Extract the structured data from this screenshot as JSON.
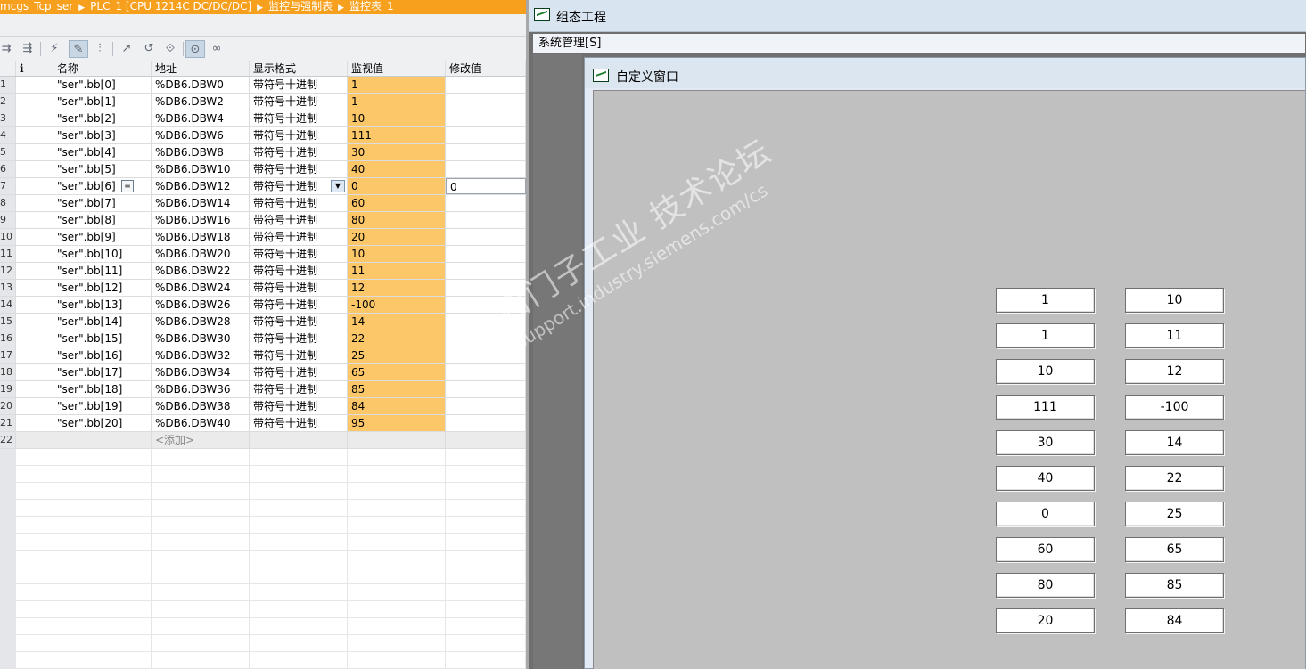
{
  "tia": {
    "breadcrumb": [
      "mcgs_Tcp_ser",
      "PLC_1 [CPU 1214C DC/DC/DC]",
      "监控与强制表",
      "监控表_1"
    ],
    "columns": {
      "info": "i",
      "name": "名称",
      "address": "地址",
      "format": "显示格式",
      "monitor": "监视值",
      "modify": "修改值"
    },
    "rows": [
      {
        "no": "1",
        "name": "\"ser\".bb[0]",
        "address": "%DB6.DBW0",
        "format": "带符号十进制",
        "monitor": "1"
      },
      {
        "no": "2",
        "name": "\"ser\".bb[1]",
        "address": "%DB6.DBW2",
        "format": "带符号十进制",
        "monitor": "1"
      },
      {
        "no": "3",
        "name": "\"ser\".bb[2]",
        "address": "%DB6.DBW4",
        "format": "带符号十进制",
        "monitor": "10"
      },
      {
        "no": "4",
        "name": "\"ser\".bb[3]",
        "address": "%DB6.DBW6",
        "format": "带符号十进制",
        "monitor": "111"
      },
      {
        "no": "5",
        "name": "\"ser\".bb[4]",
        "address": "%DB6.DBW8",
        "format": "带符号十进制",
        "monitor": "30"
      },
      {
        "no": "6",
        "name": "\"ser\".bb[5]",
        "address": "%DB6.DBW10",
        "format": "带符号十进制",
        "monitor": "40"
      },
      {
        "no": "7",
        "name": "\"ser\".bb[6]",
        "address": "%DB6.DBW12",
        "format": "带符号十进制",
        "monitor": "0",
        "modify": "0"
      },
      {
        "no": "8",
        "name": "\"ser\".bb[7]",
        "address": "%DB6.DBW14",
        "format": "带符号十进制",
        "monitor": "60"
      },
      {
        "no": "9",
        "name": "\"ser\".bb[8]",
        "address": "%DB6.DBW16",
        "format": "带符号十进制",
        "monitor": "80"
      },
      {
        "no": "10",
        "name": "\"ser\".bb[9]",
        "address": "%DB6.DBW18",
        "format": "带符号十进制",
        "monitor": "20"
      },
      {
        "no": "11",
        "name": "\"ser\".bb[10]",
        "address": "%DB6.DBW20",
        "format": "带符号十进制",
        "monitor": "10"
      },
      {
        "no": "12",
        "name": "\"ser\".bb[11]",
        "address": "%DB6.DBW22",
        "format": "带符号十进制",
        "monitor": "11"
      },
      {
        "no": "13",
        "name": "\"ser\".bb[12]",
        "address": "%DB6.DBW24",
        "format": "带符号十进制",
        "monitor": "12"
      },
      {
        "no": "14",
        "name": "\"ser\".bb[13]",
        "address": "%DB6.DBW26",
        "format": "带符号十进制",
        "monitor": "-100"
      },
      {
        "no": "15",
        "name": "\"ser\".bb[14]",
        "address": "%DB6.DBW28",
        "format": "带符号十进制",
        "monitor": "14"
      },
      {
        "no": "16",
        "name": "\"ser\".bb[15]",
        "address": "%DB6.DBW30",
        "format": "带符号十进制",
        "monitor": "22"
      },
      {
        "no": "17",
        "name": "\"ser\".bb[16]",
        "address": "%DB6.DBW32",
        "format": "带符号十进制",
        "monitor": "25"
      },
      {
        "no": "18",
        "name": "\"ser\".bb[17]",
        "address": "%DB6.DBW34",
        "format": "带符号十进制",
        "monitor": "65"
      },
      {
        "no": "19",
        "name": "\"ser\".bb[18]",
        "address": "%DB6.DBW36",
        "format": "带符号十进制",
        "monitor": "85"
      },
      {
        "no": "20",
        "name": "\"ser\".bb[19]",
        "address": "%DB6.DBW38",
        "format": "带符号十进制",
        "monitor": "84"
      },
      {
        "no": "21",
        "name": "\"ser\".bb[20]",
        "address": "%DB6.DBW40",
        "format": "带符号十进制",
        "monitor": "95"
      }
    ],
    "add_row": {
      "no": "22",
      "label": "<添加>"
    }
  },
  "mcgs": {
    "title": "组态工程",
    "menu": "系统管理[S]",
    "window_title": "自定义窗口",
    "left_values": [
      "1",
      "1",
      "10",
      "111",
      "30",
      "40",
      "0",
      "60",
      "80",
      "20"
    ],
    "right_values": [
      "10",
      "11",
      "12",
      "-100",
      "14",
      "22",
      "25",
      "65",
      "85",
      "84"
    ]
  },
  "watermark": {
    "line1": "西门子工业  技术论坛",
    "line2": "support.industry.siemens.com/cs"
  },
  "colors": {
    "title_orange": "#f7a01e",
    "monitor_value_bg": "#fcc769",
    "canvas_gray": "#c0c0c0"
  }
}
